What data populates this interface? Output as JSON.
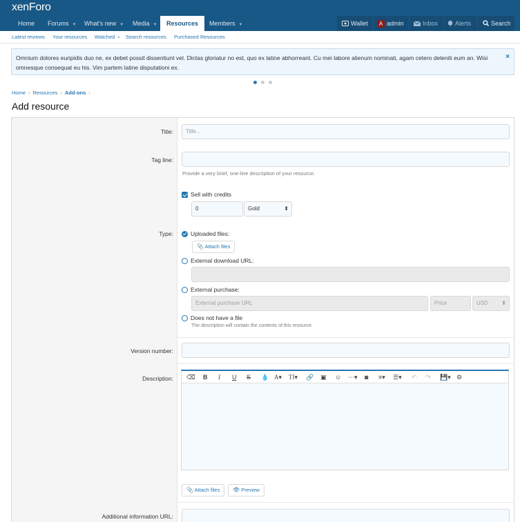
{
  "app": {
    "logo": "xenForo"
  },
  "nav": {
    "items": [
      {
        "label": "Home"
      },
      {
        "label": "Forums"
      },
      {
        "label": "What's new"
      },
      {
        "label": "Media"
      },
      {
        "label": "Resources"
      },
      {
        "label": "Members"
      }
    ],
    "right": {
      "wallet": "Wallet",
      "admin": "admin",
      "avatar_letter": "A",
      "inbox": "Inbox",
      "alerts": "Alerts",
      "search": "Search"
    }
  },
  "subnav": [
    "Latest reviews",
    "Your resources",
    "Watched",
    "Search resources",
    "Purchased Resources"
  ],
  "notice": {
    "text": "Omnium dolores euripidis duo ne, ex debet possit dissentiunt vel. Dictas gloriatur no est, quo ex latine abhorreant. Cu mei labore alienum nominati, agam cetero deleniti eum an. Wisi omnesque consequat eu his. Vim partem latine disputationi ex.",
    "close": "×"
  },
  "breadcrumb": {
    "items": [
      "Home",
      "Resources",
      "Add-ons"
    ],
    "sep": "›"
  },
  "page": {
    "title": "Add resource"
  },
  "form": {
    "title_label": "Title:",
    "title_placeholder": "Title...",
    "tagline_label": "Tag line:",
    "tagline_hint": "Provide a very brief, one-line description of your resource.",
    "sell_credits": "Sell with credits",
    "credits_value": "0",
    "currency_select": "Gold",
    "type_label": "Type:",
    "uploaded_files": "Uploaded files:",
    "attach_files": "Attach files",
    "external_download": "External download URL:",
    "external_purchase": "External purchase:",
    "purchase_url_placeholder": "External purchase URL",
    "price_placeholder": "Price",
    "price_currency": "USD",
    "no_file": "Does not have a file",
    "no_file_hint": "The description will contain the contents of this resource.",
    "version_label": "Version number:",
    "description_label": "Description:",
    "attach_files_bottom": "Attach files",
    "preview": "Preview",
    "additional_url_label": "Additional information URL:"
  },
  "colors": {
    "header": "#185886",
    "accent": "#2577b1",
    "input_bg": "#f5faff"
  }
}
